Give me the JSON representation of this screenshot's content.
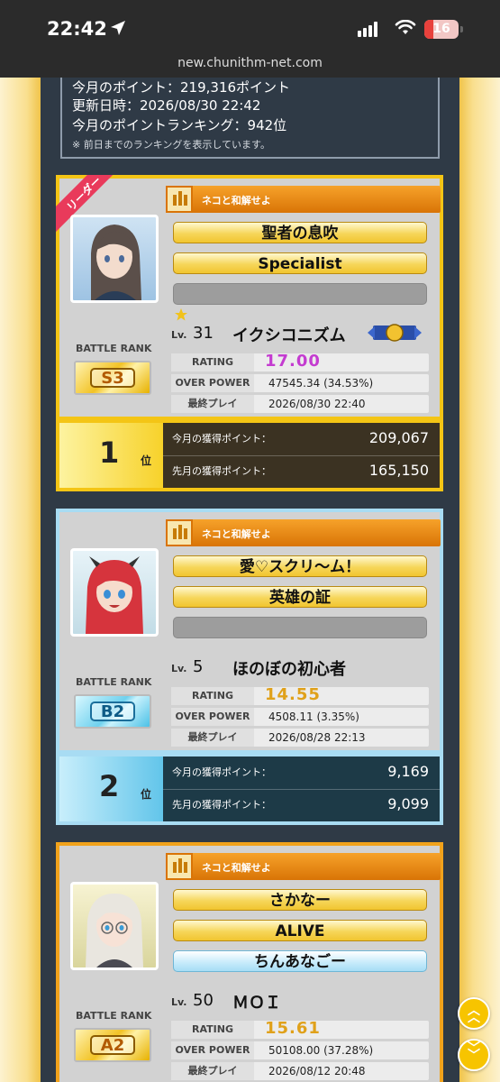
{
  "status_bar": {
    "time": "22:42",
    "battery": "16",
    "location_icon": "location-arrow-icon",
    "signal_icon": "signal-icon",
    "wifi_icon": "wifi-icon"
  },
  "url": "new.chunithm-net.com",
  "summary": {
    "month_points": "今月のポイント：219,316ポイント",
    "updated": "更新日時：2026/08/30 22:42",
    "month_ranking": "今月のポイントランキング：942位",
    "note": "※ 前日までのランキングを表示しています。"
  },
  "labels": {
    "battle_rank": "BATTLE RANK",
    "lv": "Lv.",
    "rating": "RATING",
    "over_power": "OVER POWER",
    "last_play": "最終プレイ",
    "this_month_points": "今月の獲得ポイント：",
    "last_month_points": "先月の獲得ポイント：",
    "rank_suffix": "位",
    "leader": "リーダー"
  },
  "members": [
    {
      "team": "ネコと和解せよ",
      "plates": [
        "聖者の息吹",
        "Specialist",
        ""
      ],
      "lv": "31",
      "name": "イクシコニズム",
      "battle_rank": "S3",
      "rating": "17.00",
      "over_power": "47545.34 (34.53%)",
      "last_play": "2026/08/30 22:40",
      "rank": "1",
      "this_month": "209,067",
      "last_month": "165,150",
      "leader": true
    },
    {
      "team": "ネコと和解せよ",
      "plates": [
        "愛♡スクリ～ム！",
        "英雄の証",
        ""
      ],
      "lv": "5",
      "name": "ほのぼの初心者",
      "battle_rank": "B2",
      "rating": "14.55",
      "over_power": "4508.11 (3.35%)",
      "last_play": "2026/08/28 22:13",
      "rank": "2",
      "this_month": "9,169",
      "last_month": "9,099",
      "leader": false
    },
    {
      "team": "ネコと和解せよ",
      "plates": [
        "さかなー",
        "ALIVE",
        "ちんあなごー"
      ],
      "lv": "50",
      "name": "ＭＯＩ",
      "battle_rank": "A2",
      "rating": "15.61",
      "over_power": "50108.00 (37.28%)",
      "last_play": "2026/08/12 20:48",
      "leader": false
    }
  ],
  "colors": {
    "panel": "#2f3a46",
    "gold_card": "#f4c515",
    "blue_card": "#a8dcf3",
    "orange_card": "#f1a21b",
    "rating_gold": "#e0a11a",
    "rating_rainbow": "#c43cd0"
  }
}
